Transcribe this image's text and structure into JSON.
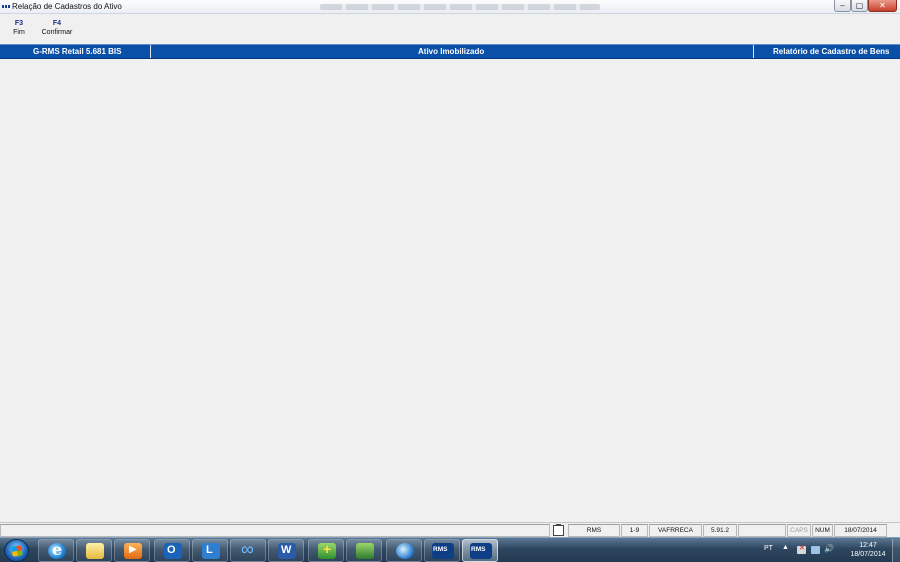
{
  "window": {
    "title": "Relação de Cadastros do Ativo",
    "controls": {
      "minimize": "–",
      "maximize": "▢",
      "close": "✕"
    }
  },
  "fkeys": [
    {
      "key": "F3",
      "label": "Fim"
    },
    {
      "key": "F4",
      "label": "Confirmar"
    }
  ],
  "header_bar": {
    "left": "G-RMS Retail 5.681 BIS",
    "center": "Ativo Imobilizado",
    "right": "Relatório de Cadastro de Bens"
  },
  "status_bar": {
    "cells": [
      "RMS",
      "1-9",
      "VAFRRECA",
      "5.91.2",
      "",
      "CAPS",
      "NUM",
      "18/07/2014"
    ]
  },
  "taskbar": {
    "apps": [
      {
        "name": "internet-explorer-icon"
      },
      {
        "name": "file-explorer-icon"
      },
      {
        "name": "media-player-icon"
      },
      {
        "name": "outlook-icon"
      },
      {
        "name": "lync-icon"
      },
      {
        "name": "sync-icon"
      },
      {
        "name": "word-icon"
      },
      {
        "name": "database-add-icon"
      },
      {
        "name": "database-icon"
      },
      {
        "name": "globe-icon"
      },
      {
        "name": "rms-icon"
      },
      {
        "name": "rms-icon"
      }
    ],
    "rms_label": "RMS",
    "tray": {
      "language": "PT",
      "time": "12:47",
      "date": "18/07/2014"
    }
  }
}
